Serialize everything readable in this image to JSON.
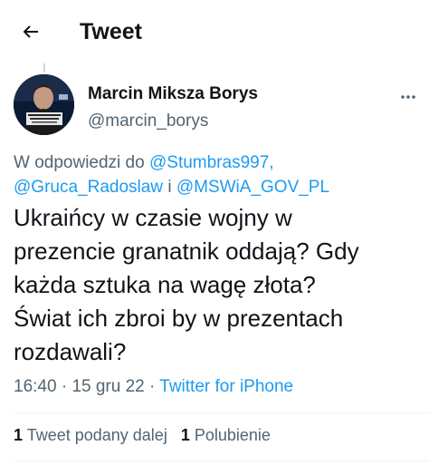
{
  "header": {
    "back_icon": "arrow-left-icon",
    "title": "Tweet"
  },
  "tweet": {
    "author": {
      "name": "Marcin Miksza Borys",
      "handle": "@marcin_borys",
      "avatar_icon": "profile-photo"
    },
    "more_icon": "more-dots-icon",
    "reply_to": {
      "prefix": "W odpowiedzi do",
      "mentions": [
        "@Stumbras997,",
        "@Gruca_Radoslaw",
        "@MSWiA_GOV_PL"
      ],
      "conjunction": "i"
    },
    "text_lines": [
      "Ukraińcy w czasie wojny w",
      "prezencie granatnik oddają? Gdy",
      "każda sztuka na wagę złota?",
      "Świat ich zbroi by w prezentach",
      "rozdawali?"
    ],
    "time": "16:40",
    "separator": "·",
    "date": "15 gru 22",
    "source": "Twitter for iPhone"
  },
  "stats": {
    "retweets_count": "1",
    "retweets_label": "Tweet podany dalej",
    "likes_count": "1",
    "likes_label": "Polubienie"
  },
  "colors": {
    "accent": "#1d9bf0",
    "text_primary": "#0f1419",
    "text_secondary": "#536471",
    "divider": "#eff3f4"
  }
}
